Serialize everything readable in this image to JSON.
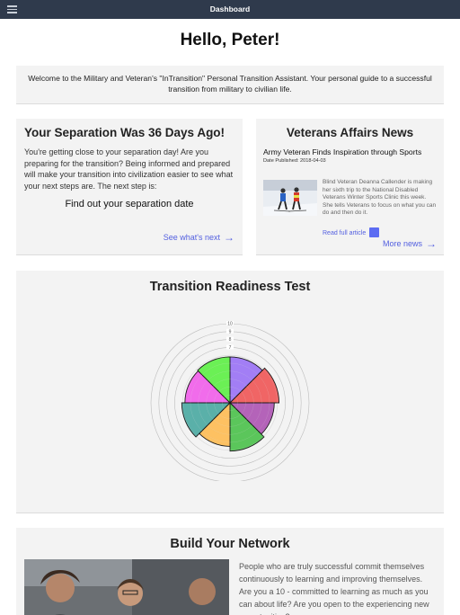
{
  "topbar": {
    "title": "Dashboard",
    "menu_icon": "hamburger-menu-icon"
  },
  "greeting": "Hello, Peter!",
  "welcome": "Welcome to the Military and Veteran's \"InTransition\" Personal Transition Assistant. Your personal guide to a successful transition from military to civilian life.",
  "separation": {
    "title": "Your Separation Was 36 Days Ago!",
    "body": "You're getting close to your separation day! Are you preparing for the transition? Being informed and prepared will make your transition into civilization easier to see what your next steps are. The next step is:",
    "next_step": "Find out your separation date",
    "link": "See what's next"
  },
  "news": {
    "title": "Veterans Affairs News",
    "headline": "Army Veteran Finds Inspiration through Sports",
    "date": "Date Published: 2018-04-03",
    "blurb": "Blind Veteran Deanna Callender is making her sixth trip to the National Disabled Veterans Winter Sports Clinic this week. She tells Veterans to focus on what you can do and then do it.",
    "read_link": "Read full article",
    "more_link": "More news"
  },
  "readiness": {
    "title": "Transition Readiness Test",
    "ticks": [
      "10",
      "9",
      "8",
      "7"
    ]
  },
  "chart_data": {
    "type": "polar-area",
    "title": "Transition Readiness Test",
    "rmax": 10,
    "tick_labels": [
      "10",
      "9",
      "8",
      "7"
    ],
    "segments": [
      {
        "value": 5.8,
        "color": "#8a5cf5"
      },
      {
        "value": 6.2,
        "color": "#ee3c3c"
      },
      {
        "value": 5.6,
        "color": "#a23aa8"
      },
      {
        "value": 6.1,
        "color": "#2fb82f"
      },
      {
        "value": 5.5,
        "color": "#ffb238"
      },
      {
        "value": 6.1,
        "color": "#2e9c94"
      },
      {
        "value": 5.7,
        "color": "#f045e8"
      },
      {
        "value": 5.8,
        "color": "#44ee28"
      }
    ]
  },
  "network": {
    "title": "Build Your Network",
    "body": "People who are truly successful commit themselves continuously to learning and improving themselves. Are you a 10 - committed to learning as much as you can about life? Are you open to the experiencing new opportunities?"
  }
}
